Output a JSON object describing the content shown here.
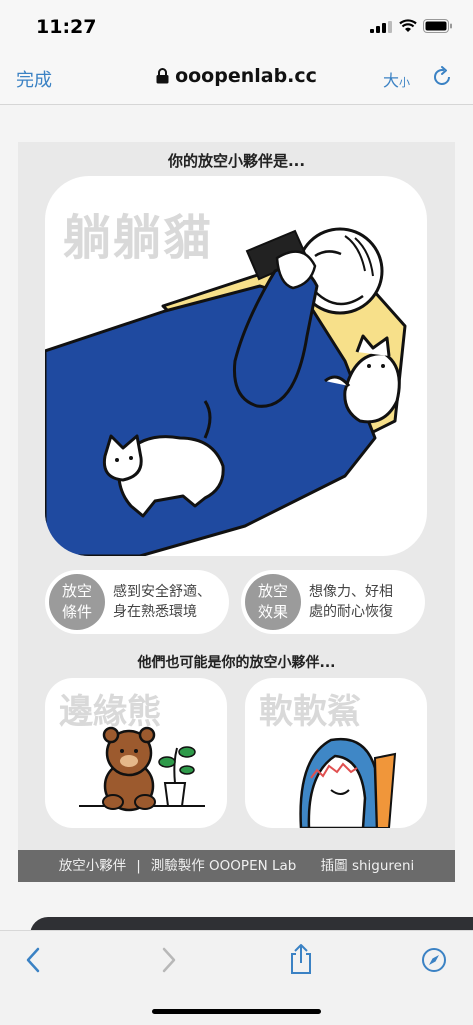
{
  "status_bar": {
    "time": "11:27"
  },
  "nav_bar": {
    "done_label": "完成",
    "url": "ooopenlab.cc",
    "text_size_big": "大",
    "text_size_small": "小"
  },
  "result": {
    "title": "你的放空小夥伴是...",
    "name": "躺躺貓",
    "attributes": [
      {
        "badge_line1": "放空",
        "badge_line2": "條件",
        "desc_line1": "感到安全舒適、",
        "desc_line2": "身在熟悉環境"
      },
      {
        "badge_line1": "放空",
        "badge_line2": "效果",
        "desc_line1": "想像力、好相",
        "desc_line2": "處的耐心恢復"
      }
    ],
    "others_title": "他們也可能是你的放空小夥伴...",
    "others": [
      {
        "name": "邊緣熊"
      },
      {
        "name": "軟軟鯊"
      }
    ],
    "footer": {
      "item1": "放空小夥伴",
      "separator": "|",
      "item2": "測驗製作 OOOPEN Lab",
      "item3": "插圖 shigureni"
    }
  },
  "colors": {
    "accent": "#3b82c4",
    "card_bg": "#e9e9e9",
    "badge": "#9b9b9b",
    "footer_bg": "#6b6b6b",
    "blanket": "#1f4aa0",
    "pillow": "#f7e08a"
  },
  "icons": [
    "lock-icon",
    "reload-icon",
    "back-icon",
    "forward-icon",
    "share-icon",
    "compass-icon",
    "signal-icon",
    "wifi-icon",
    "battery-icon"
  ]
}
